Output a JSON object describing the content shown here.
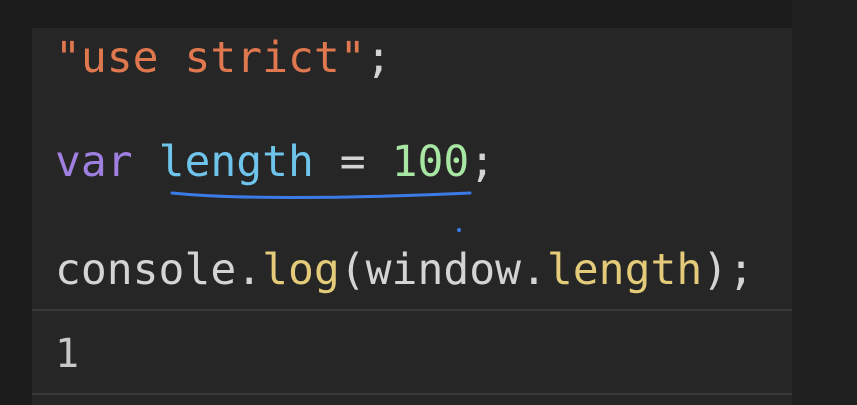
{
  "code": {
    "line1": {
      "string": "\"use strict\"",
      "semicolon": ";"
    },
    "line2": {
      "keyword": "var",
      "variable": "length",
      "operator": "=",
      "number": "100",
      "semicolon": ";"
    },
    "line3": {
      "object": "console",
      "dot1": ".",
      "method": "log",
      "open_paren": "(",
      "arg_object": "window",
      "dot2": ".",
      "arg_property": "length",
      "close_paren": ")",
      "semicolon": ";"
    }
  },
  "output": {
    "value": "1"
  },
  "colors": {
    "string": "#e0784f",
    "keyword": "#9f7fe0",
    "variable": "#6ec4ea",
    "number": "#a8e6a3",
    "function": "#e4cb7a",
    "annotation_underline": "#3b7be8"
  }
}
